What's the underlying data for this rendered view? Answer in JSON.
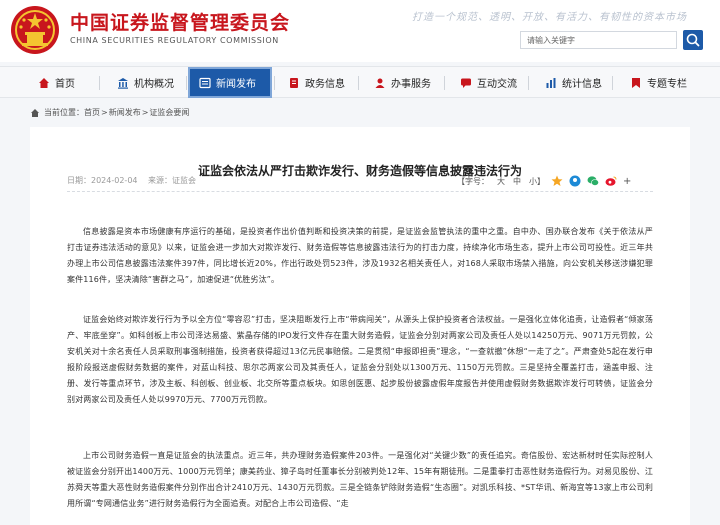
{
  "header": {
    "org_name_cn": "中国证券监督管理委员会",
    "org_name_en": "CHINA SECURITIES REGULATORY COMMISSION",
    "slogan": "打造一个规范、透明、开放、有活力、有韧性的资本市场",
    "search_placeholder": "请输入关键字"
  },
  "nav": {
    "items": [
      {
        "label": "首页",
        "icon": "home-icon"
      },
      {
        "label": "机构概况",
        "icon": "building-icon"
      },
      {
        "label": "新闻发布",
        "icon": "news-icon"
      },
      {
        "label": "政务信息",
        "icon": "document-icon"
      },
      {
        "label": "办事服务",
        "icon": "service-icon"
      },
      {
        "label": "互动交流",
        "icon": "chat-icon"
      },
      {
        "label": "统计信息",
        "icon": "chart-icon"
      },
      {
        "label": "专题专栏",
        "icon": "topic-icon"
      }
    ],
    "active_index": 2
  },
  "breadcrumb": {
    "prefix": "当前位置：",
    "items": [
      "首页",
      "新闻发布",
      "证监会要闻"
    ],
    "separator": ">"
  },
  "article": {
    "title": "证监会依法从严打击欺诈发行、财务造假等信息披露违法行为",
    "date_label": "日期：",
    "date": "2024-02-04",
    "source_label": "来源：",
    "source": "证监会",
    "font_size_label": "【字号：",
    "font_large": "大",
    "font_medium": "中",
    "font_small": "小",
    "font_size_close": "】",
    "paragraphs": [
      "信息披露是资本市场健康有序运行的基础，是投资者作出价值判断和投资决策的前提，是证监会监管执法的重中之重。自中办、国办联合发布《关于依法从严打击证券违法活动的意见》以来，证监会进一步加大对欺诈发行、财务造假等信息披露违法行为的打击力度，持续净化市场生态，提升上市公司可投性。近三年共办理上市公司信息披露违法案件397件，同比增长近20%，作出行政处罚523件，涉及1932名相关责任人，对168人采取市场禁入措施，向公安机关移送涉嫌犯罪案件116件，坚决清除“害群之马”，加速促进“优胜劣汰”。",
      "证监会始终对欺诈发行行为予以全方位“零容忍”打击，坚决阻断发行上市“带病闯关”，从源头上保护投资者合法权益。一是强化立体化追责，让造假者“倾家荡产、牢底坐穿”。如科创板上市公司泽达易盛、紫晶存储的IPO发行文件存在重大财务造假，证监会分别对两家公司及责任人处以14250万元、9071万元罚款，公安机关对十余名责任人员采取刑事强制措施，投资者获得超过13亿元民事赔偿。二是贯彻“申报即担责”理念，“一查就撤”休想“一走了之”。严肃查处5起在发行申报阶段报送虚假财务数据的案件，对蓝山科技、思尔芯两家公司及其责任人，证监会分别处以1300万元、1150万元罚款。三是坚持全覆盖打击，涵盖申报、注册、发行等重点环节，涉及主板、科创板、创业板、北交所等重点板块。如思创医惠、起步股份披露虚假年度报告并使用虚假财务数据欺诈发行可转债，证监会分别对两家公司及责任人处以9970万元、7700万元罚款。",
      "上市公司财务造假一直是证监会的执法重点。近三年，共办理财务造假案件203件。一是强化对“关键少数”的责任追究。奇信股份、宏达新材时任实际控制人被证监会分别开出1400万元、1000万元罚单；康美药业、獐子岛时任董事长分别被判处12年、15年有期徒刑。二是重拳打击恶性财务造假行为。对易见股份、江苏舜天等重大恶性财务造假案件分别作出合计2410万元、1430万元罚款。三是全链条铲除财务造假“生态圈”。对凯乐科技、*ST华讯、新海宜等13家上市公司利用所谓“专网通信业务”进行财务造假行为全面追责。对配合上市公司造假、“走"
    ]
  },
  "colors": {
    "brand_red": "#c8161d",
    "nav_active": "#1d5aa8",
    "wechat_green": "#2aae67",
    "weibo_red": "#e6162d"
  }
}
